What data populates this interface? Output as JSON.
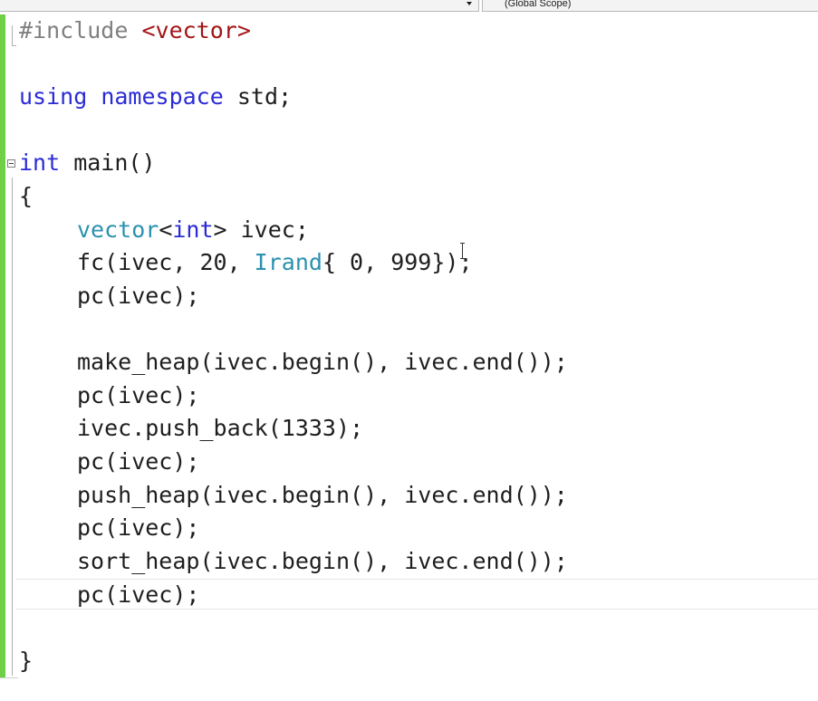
{
  "toolbar": {
    "scope_dropdown": "(Global Scope)"
  },
  "editor": {
    "lines": {
      "l1_a": "#include ",
      "l1_b": "<vector>",
      "l3_a": "using",
      "l3_b": " ",
      "l3_c": "namespace",
      "l3_d": " std;",
      "l5_a": "int",
      "l5_b": " main()",
      "l6": "{",
      "l7_a": "vector",
      "l7_b": "<",
      "l7_c": "int",
      "l7_d": "> ivec;",
      "l8_a": "fc(ivec, 20, ",
      "l8_b": "Irand",
      "l8_c": "{ 0, 999});",
      "l9": "pc(ivec);",
      "l11": "make_heap(ivec.begin(), ivec.end());",
      "l12": "pc(ivec);",
      "l13": "ivec.push_back(1333);",
      "l14": "pc(ivec);",
      "l15": "push_heap(ivec.begin(), ivec.end());",
      "l16": "pc(ivec);",
      "l17": "sort_heap(ivec.begin(), ivec.end());",
      "l18": "pc(ivec);",
      "l20": "}"
    }
  },
  "colors": {
    "keyword": "#2b2bd6",
    "preprocessor": "#808080",
    "string": "#a31515",
    "type": "#2b91af",
    "change_bar": "#6fd045"
  }
}
